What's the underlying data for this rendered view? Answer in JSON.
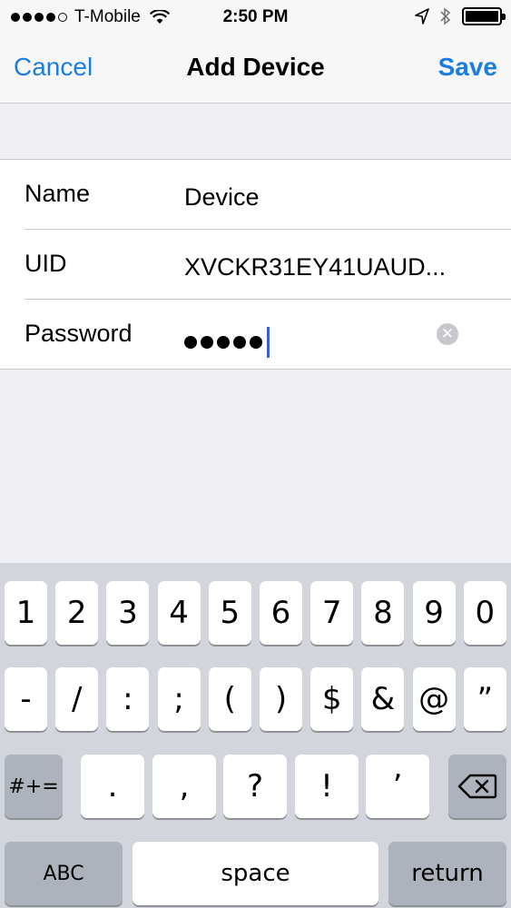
{
  "status_bar": {
    "carrier": "T-Mobile",
    "time": "2:50 PM",
    "signal_filled": 4,
    "signal_total": 5,
    "icons": [
      "wifi-icon",
      "location-arrow-icon",
      "bluetooth-icon",
      "battery-icon"
    ]
  },
  "nav": {
    "cancel_label": "Cancel",
    "title": "Add Device",
    "save_label": "Save",
    "accent_color": "#1b7ede"
  },
  "form": {
    "rows": [
      {
        "label": "Name",
        "value": "Device"
      },
      {
        "label": "UID",
        "value": "XVCKR31EY41UAUD..."
      },
      {
        "label": "Password",
        "masked_length": 5
      }
    ],
    "clear_icon": "clear-circle-icon"
  },
  "keyboard": {
    "row1": [
      "1",
      "2",
      "3",
      "4",
      "5",
      "6",
      "7",
      "8",
      "9",
      "0"
    ],
    "row2": [
      "-",
      "/",
      ":",
      ";",
      "(",
      ")",
      "$",
      "&",
      "@",
      "”"
    ],
    "row3_mode": "#+=",
    "row3": [
      ".",
      ",",
      "?",
      "!",
      "’"
    ],
    "backspace_icon": "backspace-icon",
    "abc_label": "ABC",
    "space_label": "space",
    "return_label": "return"
  }
}
